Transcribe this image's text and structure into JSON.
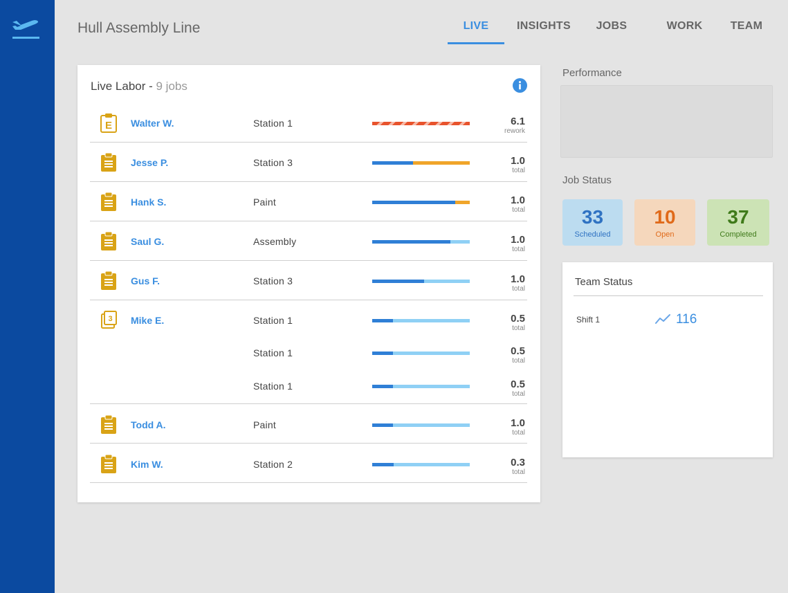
{
  "app": {
    "title": "Hull Assembly Line",
    "logo_icon": "plane-departure-icon"
  },
  "nav": {
    "tabs": [
      {
        "label": "LIVE",
        "active": true
      },
      {
        "label": "INSIGHTS",
        "active": false
      },
      {
        "label": "JOBS",
        "active": false
      },
      {
        "label": "WORK",
        "active": false
      },
      {
        "label": "TEAM",
        "active": false
      }
    ]
  },
  "colors": {
    "brand": "#0b4aa0",
    "accent": "#3a8ee0",
    "progress_dark": "#2f7fd6",
    "progress_light": "#8fd0f5",
    "progress_orange": "#f0a52a",
    "rework": "#e8532c",
    "job_icon": "#d9a316"
  },
  "live_labor": {
    "title": "Live Labor - ",
    "count_label": "9 jobs",
    "info_icon": "info-icon",
    "rows": [
      {
        "name": "Walter W.",
        "icon": "clipboard-e-icon",
        "jobs": [
          {
            "station": "Station 1",
            "progress": 1.0,
            "fill": "rework",
            "value": "6.1",
            "unit": "rework"
          }
        ]
      },
      {
        "name": "Jesse P.",
        "icon": "clipboard-icon",
        "jobs": [
          {
            "station": "Station 3",
            "progress": 0.42,
            "fill": "orange",
            "value": "1.0",
            "unit": "total"
          }
        ]
      },
      {
        "name": "Hank S.",
        "icon": "clipboard-icon",
        "jobs": [
          {
            "station": "Paint",
            "progress": 0.85,
            "fill": "orange",
            "value": "1.0",
            "unit": "total"
          }
        ]
      },
      {
        "name": "Saul G.",
        "icon": "clipboard-icon",
        "jobs": [
          {
            "station": "Assembly",
            "progress": 0.8,
            "fill": "light",
            "value": "1.0",
            "unit": "total"
          }
        ]
      },
      {
        "name": "Gus F.",
        "icon": "clipboard-icon",
        "jobs": [
          {
            "station": "Station 3",
            "progress": 0.53,
            "fill": "light",
            "value": "1.0",
            "unit": "total"
          }
        ]
      },
      {
        "name": "Mike E.",
        "icon": "clipboard-stack-3-icon",
        "jobs": [
          {
            "station": "Station 1",
            "progress": 0.21,
            "fill": "light",
            "value": "0.5",
            "unit": "total"
          },
          {
            "station": "Station 1",
            "progress": 0.21,
            "fill": "light",
            "value": "0.5",
            "unit": "total"
          },
          {
            "station": "Station 1",
            "progress": 0.21,
            "fill": "light",
            "value": "0.5",
            "unit": "total"
          }
        ]
      },
      {
        "name": "Todd A.",
        "icon": "clipboard-icon",
        "jobs": [
          {
            "station": "Paint",
            "progress": 0.21,
            "fill": "light",
            "value": "1.0",
            "unit": "total"
          }
        ]
      },
      {
        "name": "Kim W.",
        "icon": "clipboard-icon",
        "jobs": [
          {
            "station": "Station 2",
            "progress": 0.22,
            "fill": "light",
            "value": "0.3",
            "unit": "total"
          }
        ]
      }
    ]
  },
  "performance": {
    "title": "Performance"
  },
  "job_status": {
    "title": "Job Status",
    "tiles": [
      {
        "count": "33",
        "label": "Scheduled",
        "bg": "#bcdcf0",
        "fg": "#2f72c2"
      },
      {
        "count": "10",
        "label": "Open",
        "bg": "#f5d7bc",
        "fg": "#e06a1a"
      },
      {
        "count": "37",
        "label": "Completed",
        "bg": "#cce3b5",
        "fg": "#3f7a1a"
      }
    ]
  },
  "team_status": {
    "title": "Team Status",
    "shifts": [
      {
        "label": "Shift 1",
        "icon": "trend-line-icon",
        "value": "116"
      }
    ]
  }
}
